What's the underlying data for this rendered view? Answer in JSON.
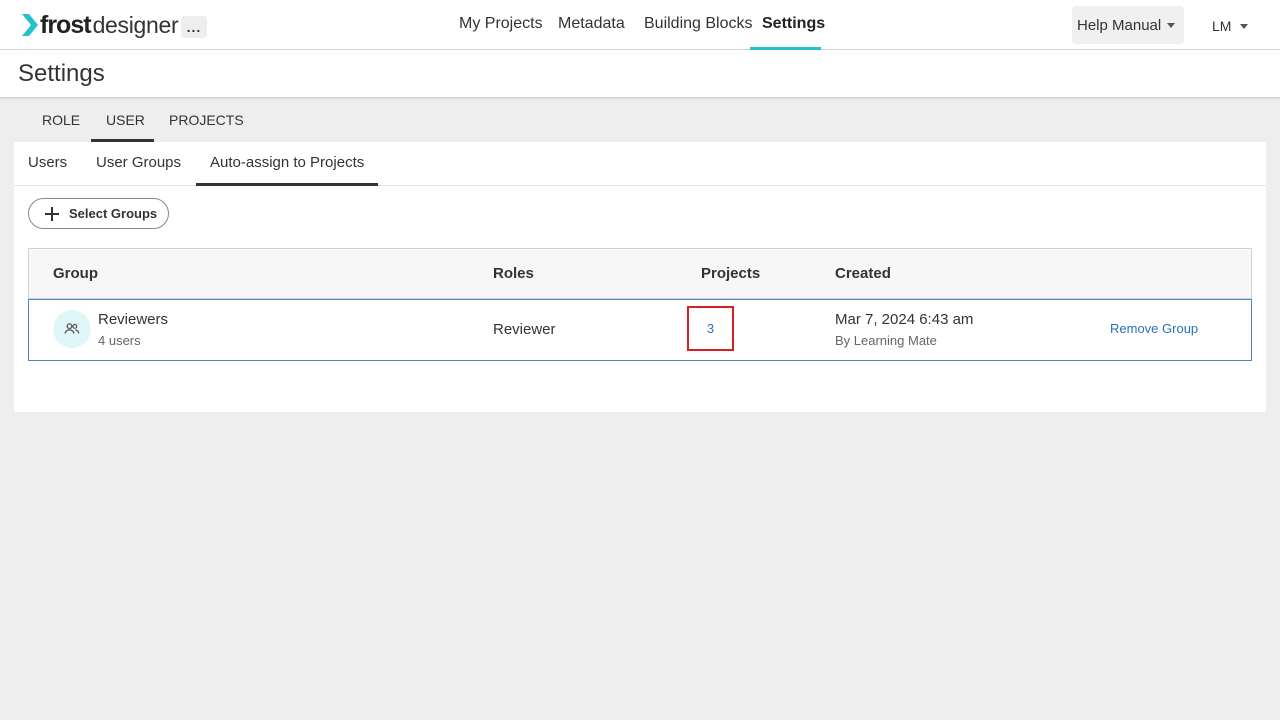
{
  "brand": {
    "logo_bold": "frost",
    "logo_light": "designer",
    "more_label": "..."
  },
  "nav": {
    "items": [
      {
        "label": "My Projects"
      },
      {
        "label": "Metadata"
      },
      {
        "label": "Building Blocks"
      },
      {
        "label": "Settings",
        "active": true
      }
    ],
    "help_label": "Help Manual",
    "user_initials": "LM",
    "accent_color": "#26c0cf"
  },
  "page": {
    "title": "Settings"
  },
  "top_tabs": [
    {
      "label": "ROLE"
    },
    {
      "label": "USER",
      "active": true
    },
    {
      "label": "PROJECTS"
    }
  ],
  "sub_tabs": [
    {
      "label": "Users"
    },
    {
      "label": "User Groups"
    },
    {
      "label": "Auto-assign to Projects",
      "active": true
    }
  ],
  "actions": {
    "select_groups_label": "Select Groups"
  },
  "table": {
    "headers": {
      "group": "Group",
      "roles": "Roles",
      "projects": "Projects",
      "created": "Created"
    },
    "rows": [
      {
        "group_name": "Reviewers",
        "user_count": "4 users",
        "role": "Reviewer",
        "projects": "3",
        "created_date": "Mar 7, 2024 6:43 am",
        "created_by": "By Learning Mate",
        "action_label": "Remove Group",
        "icon": "group-icon"
      }
    ]
  },
  "colors": {
    "link": "#2a6fb8",
    "highlight_border": "#d81e1e",
    "row_border": "#4a86c8"
  }
}
